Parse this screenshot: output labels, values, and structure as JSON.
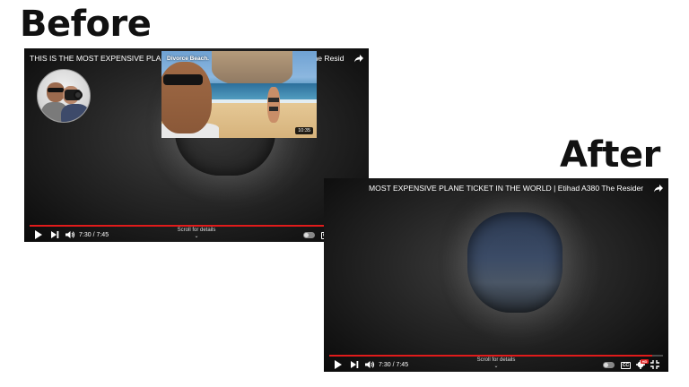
{
  "headings": {
    "before": "Before",
    "after": "After"
  },
  "before_player": {
    "title": "THIS IS THE MOST EXPENSIVE PLANE TICKET IN THE WORLD | Etihad A380 The Residence",
    "time": "7:30 / 7:45",
    "scroll_hint": "Scroll for details",
    "progress": 0.968,
    "endcard": {
      "title": "Divorce Beach.",
      "duration": "10:35"
    }
  },
  "after_player": {
    "title": "MOST EXPENSIVE PLANE TICKET IN THE WORLD | Etihad A380 The Residence",
    "time": "7:30 / 7:45",
    "scroll_hint": "Scroll for details",
    "progress": 0.968
  },
  "controls": {
    "cc_label": "CC",
    "hd_label": "HD"
  },
  "colors": {
    "progress": "#e01b1b",
    "heading": "#111111"
  },
  "icons": [
    "share-icon",
    "play-icon",
    "next-icon",
    "volume-icon",
    "autoplay-toggle",
    "captions-icon",
    "settings-icon",
    "exit-fullscreen-icon",
    "chevron-down-icon"
  ]
}
